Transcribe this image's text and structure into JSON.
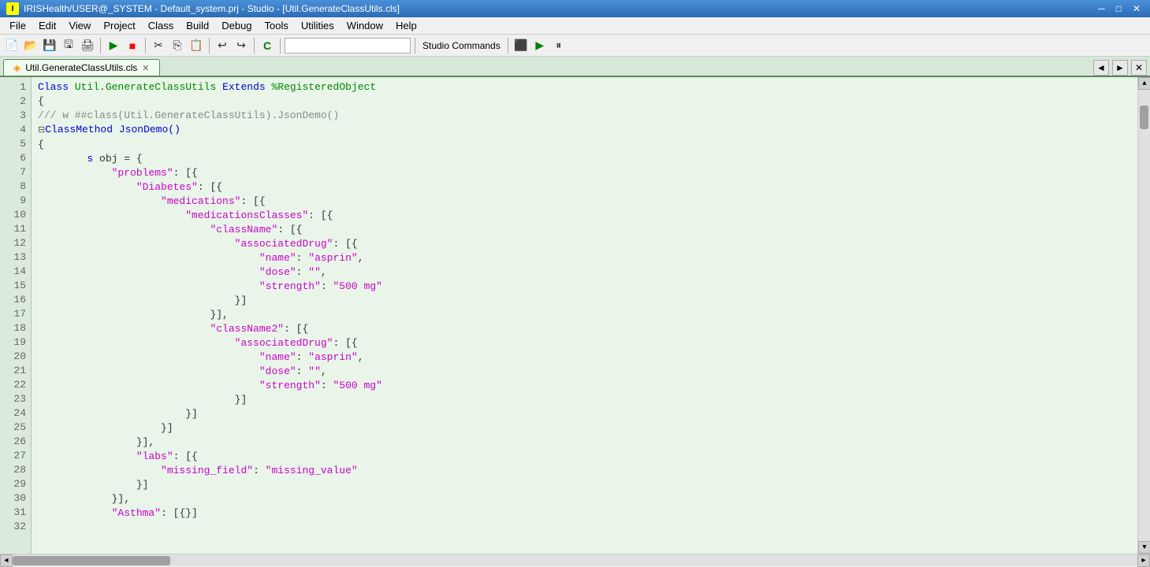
{
  "titleBar": {
    "text": "IRISHealth/USER@_SYSTEM - Default_system.prj - Studio - [Util.GenerateClassUtils.cls]",
    "icon": "I"
  },
  "menuBar": {
    "items": [
      "File",
      "Edit",
      "View",
      "Project",
      "Class",
      "Build",
      "Debug",
      "Tools",
      "Utilities",
      "Window",
      "Help"
    ]
  },
  "toolbar": {
    "studioCommands": "Studio Commands"
  },
  "tabs": [
    {
      "label": "Util.GenerateClassUtils.cls",
      "active": true
    }
  ],
  "code": {
    "lines": [
      {
        "num": 1,
        "indent": 0,
        "content": "Class Util.GenerateClassUtils Extends %RegisteredObject",
        "tokens": [
          {
            "t": "kw",
            "v": "Class"
          },
          {
            "t": "plain",
            "v": " "
          },
          {
            "t": "cls-name",
            "v": "Util.GenerateClassUtils"
          },
          {
            "t": "plain",
            "v": " "
          },
          {
            "t": "kw",
            "v": "Extends"
          },
          {
            "t": "plain",
            "v": " "
          },
          {
            "t": "cls-name",
            "v": "%RegisteredObject"
          }
        ]
      },
      {
        "num": 2,
        "content": "{",
        "tokens": [
          {
            "t": "punct",
            "v": "{"
          }
        ]
      },
      {
        "num": 3,
        "content": "",
        "tokens": []
      },
      {
        "num": 4,
        "content": "/// w ##class(Util.GenerateClassUtils).JsonDemo()",
        "tokens": [
          {
            "t": "comment",
            "v": "/// w ##class(Util.GenerateClassUtils).JsonDemo()"
          }
        ]
      },
      {
        "num": 5,
        "content": "ClassMethod JsonDemo()",
        "tokens": [
          {
            "t": "kw",
            "v": "ClassMethod"
          },
          {
            "t": "plain",
            "v": " "
          },
          {
            "t": "method",
            "v": "JsonDemo()"
          }
        ],
        "fold": true
      },
      {
        "num": 6,
        "content": "{",
        "tokens": [
          {
            "t": "punct",
            "v": "{"
          }
        ]
      },
      {
        "num": 7,
        "content": "        s obj = {",
        "tokens": [
          {
            "t": "plain",
            "v": "        "
          },
          {
            "t": "kw",
            "v": "s"
          },
          {
            "t": "plain",
            "v": " obj = "
          },
          {
            "t": "punct",
            "v": "{"
          }
        ]
      },
      {
        "num": 8,
        "content": "            \"problems\": [{",
        "tokens": [
          {
            "t": "plain",
            "v": "            "
          },
          {
            "t": "key",
            "v": "\"problems\""
          },
          {
            "t": "colon",
            "v": ": [{"
          }
        ]
      },
      {
        "num": 9,
        "content": "                \"Diabetes\": [{",
        "tokens": [
          {
            "t": "plain",
            "v": "                "
          },
          {
            "t": "key",
            "v": "\"Diabetes\""
          },
          {
            "t": "colon",
            "v": ": [{"
          }
        ]
      },
      {
        "num": 10,
        "content": "                    \"medications\": [{",
        "tokens": [
          {
            "t": "plain",
            "v": "                    "
          },
          {
            "t": "key",
            "v": "\"medications\""
          },
          {
            "t": "colon",
            "v": ": [{"
          }
        ]
      },
      {
        "num": 11,
        "content": "                        \"medicationsClasses\": [{",
        "tokens": [
          {
            "t": "plain",
            "v": "                        "
          },
          {
            "t": "key",
            "v": "\"medicationsClasses\""
          },
          {
            "t": "colon",
            "v": ": [{"
          }
        ]
      },
      {
        "num": 12,
        "content": "                            \"className\": [{",
        "tokens": [
          {
            "t": "plain",
            "v": "                            "
          },
          {
            "t": "key",
            "v": "\"className\""
          },
          {
            "t": "colon",
            "v": ": [{"
          }
        ]
      },
      {
        "num": 13,
        "content": "                                \"associatedDrug\": [{",
        "tokens": [
          {
            "t": "plain",
            "v": "                                "
          },
          {
            "t": "key",
            "v": "\"associatedDrug\""
          },
          {
            "t": "colon",
            "v": ": [{"
          }
        ]
      },
      {
        "num": 14,
        "content": "                                    \"name\": \"asprin\",",
        "tokens": [
          {
            "t": "plain",
            "v": "                                    "
          },
          {
            "t": "key",
            "v": "\"name\""
          },
          {
            "t": "colon",
            "v": ": "
          },
          {
            "t": "str",
            "v": "\"asprin\""
          },
          {
            "t": "plain",
            "v": ","
          }
        ]
      },
      {
        "num": 15,
        "content": "                                    \"dose\": \"\",",
        "tokens": [
          {
            "t": "plain",
            "v": "                                    "
          },
          {
            "t": "key",
            "v": "\"dose\""
          },
          {
            "t": "colon",
            "v": ": "
          },
          {
            "t": "str",
            "v": "\"\""
          },
          {
            "t": "plain",
            "v": ","
          }
        ]
      },
      {
        "num": 16,
        "content": "                                    \"strength\": \"500 mg\"",
        "tokens": [
          {
            "t": "plain",
            "v": "                                    "
          },
          {
            "t": "key",
            "v": "\"strength\""
          },
          {
            "t": "colon",
            "v": ": "
          },
          {
            "t": "str",
            "v": "\"500 mg\""
          }
        ]
      },
      {
        "num": 17,
        "content": "                                }]",
        "tokens": [
          {
            "t": "plain",
            "v": "                                "
          },
          {
            "t": "punct",
            "v": "}]"
          }
        ]
      },
      {
        "num": 18,
        "content": "                            }],",
        "tokens": [
          {
            "t": "plain",
            "v": "                            "
          },
          {
            "t": "punct",
            "v": "}],"
          }
        ]
      },
      {
        "num": 19,
        "content": "                            \"className2\": [{",
        "tokens": [
          {
            "t": "plain",
            "v": "                            "
          },
          {
            "t": "key",
            "v": "\"className2\""
          },
          {
            "t": "colon",
            "v": ": [{"
          }
        ]
      },
      {
        "num": 20,
        "content": "                                \"associatedDrug\": [{",
        "tokens": [
          {
            "t": "plain",
            "v": "                                "
          },
          {
            "t": "key",
            "v": "\"associatedDrug\""
          },
          {
            "t": "colon",
            "v": ": [{"
          }
        ]
      },
      {
        "num": 21,
        "content": "                                    \"name\": \"asprin\",",
        "tokens": [
          {
            "t": "plain",
            "v": "                                    "
          },
          {
            "t": "key",
            "v": "\"name\""
          },
          {
            "t": "colon",
            "v": ": "
          },
          {
            "t": "str",
            "v": "\"asprin\""
          },
          {
            "t": "plain",
            "v": ","
          }
        ]
      },
      {
        "num": 22,
        "content": "                                    \"dose\": \"\",",
        "tokens": [
          {
            "t": "plain",
            "v": "                                    "
          },
          {
            "t": "key",
            "v": "\"dose\""
          },
          {
            "t": "colon",
            "v": ": "
          },
          {
            "t": "str",
            "v": "\"\""
          },
          {
            "t": "plain",
            "v": ","
          }
        ]
      },
      {
        "num": 23,
        "content": "                                    \"strength\": \"500 mg\"",
        "tokens": [
          {
            "t": "plain",
            "v": "                                    "
          },
          {
            "t": "key",
            "v": "\"strength\""
          },
          {
            "t": "colon",
            "v": ": "
          },
          {
            "t": "str",
            "v": "\"500 mg\""
          }
        ]
      },
      {
        "num": 24,
        "content": "                                }]",
        "tokens": [
          {
            "t": "plain",
            "v": "                                "
          },
          {
            "t": "punct",
            "v": "}]"
          }
        ]
      },
      {
        "num": 25,
        "content": "                        }]",
        "tokens": [
          {
            "t": "plain",
            "v": "                        "
          },
          {
            "t": "punct",
            "v": "}]"
          }
        ]
      },
      {
        "num": 26,
        "content": "                    }]",
        "tokens": [
          {
            "t": "plain",
            "v": "                    "
          },
          {
            "t": "punct",
            "v": "}]"
          }
        ]
      },
      {
        "num": 27,
        "content": "                }],",
        "tokens": [
          {
            "t": "plain",
            "v": "                "
          },
          {
            "t": "punct",
            "v": "}],"
          }
        ]
      },
      {
        "num": 28,
        "content": "                \"labs\": [{",
        "tokens": [
          {
            "t": "plain",
            "v": "                "
          },
          {
            "t": "key",
            "v": "\"labs\""
          },
          {
            "t": "colon",
            "v": ": [{"
          }
        ]
      },
      {
        "num": 29,
        "content": "                    \"missing_field\": \"missing_value\"",
        "tokens": [
          {
            "t": "plain",
            "v": "                    "
          },
          {
            "t": "key",
            "v": "\"missing_field\""
          },
          {
            "t": "colon",
            "v": ": "
          },
          {
            "t": "str",
            "v": "\"missing_value\""
          }
        ]
      },
      {
        "num": 30,
        "content": "                }]",
        "tokens": [
          {
            "t": "plain",
            "v": "                "
          },
          {
            "t": "punct",
            "v": "}]"
          }
        ]
      },
      {
        "num": 31,
        "content": "            }],",
        "tokens": [
          {
            "t": "plain",
            "v": "            "
          },
          {
            "t": "punct",
            "v": "}],"
          }
        ]
      },
      {
        "num": 32,
        "content": "            \"Asthma\": [{}]",
        "tokens": [
          {
            "t": "plain",
            "v": "            "
          },
          {
            "t": "key",
            "v": "\"Asthma\""
          },
          {
            "t": "colon",
            "v": ": "
          },
          {
            "t": "punct",
            "v": "[{}]"
          }
        ]
      }
    ]
  },
  "scrollbar": {
    "v_arrows": [
      "▲",
      "▼"
    ],
    "h_arrows": [
      "◄",
      "►"
    ]
  }
}
